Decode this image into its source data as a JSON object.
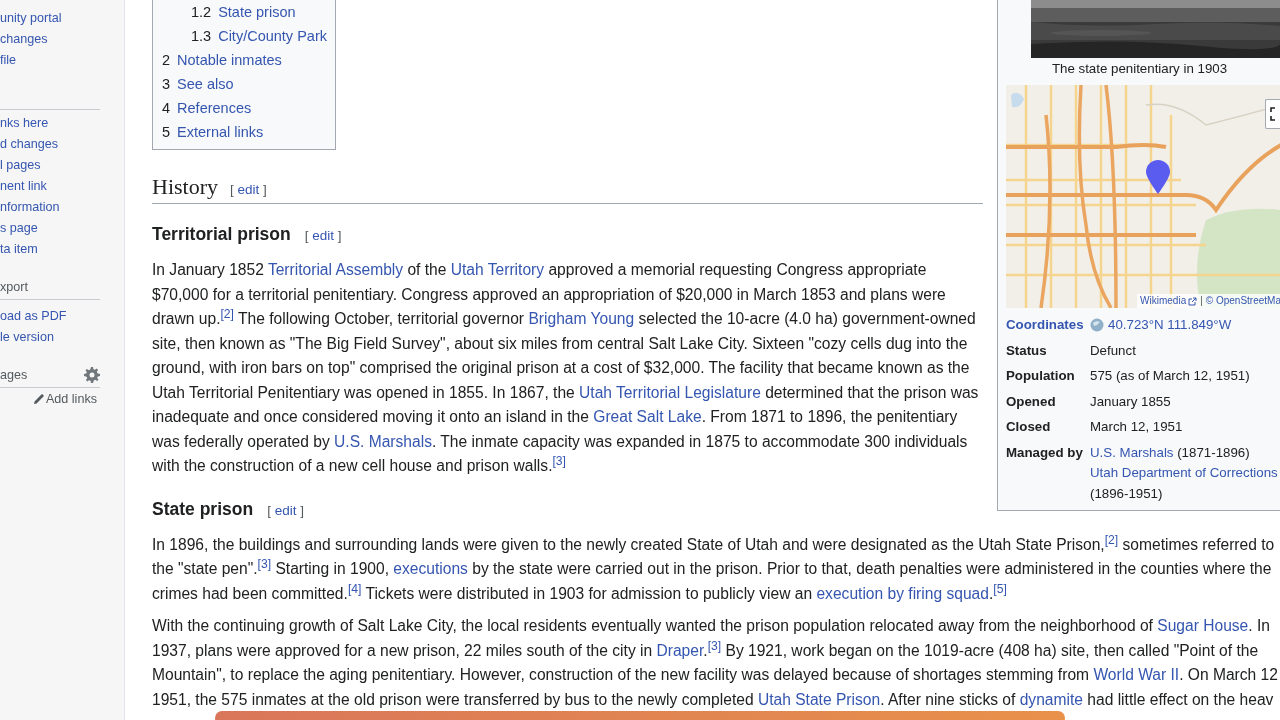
{
  "sidebar": {
    "groups": [
      {
        "items": [
          "unity portal",
          "changes",
          "file"
        ]
      },
      {
        "divider": true,
        "items": [
          "nks here",
          "d changes",
          "l pages",
          "nent link",
          "nformation",
          "s page",
          "ta item"
        ]
      },
      {
        "heading": "xport",
        "items": [
          "oad as PDF",
          "le version"
        ]
      },
      {
        "heading": "ages",
        "settings": true,
        "add_links": "Add links"
      }
    ]
  },
  "toc": {
    "items": [
      {
        "children": [
          {
            "number": "1.2",
            "label": "State prison"
          },
          {
            "number": "1.3",
            "label": "City/County Park"
          }
        ]
      },
      {
        "number": "2",
        "label": "Notable inmates"
      },
      {
        "number": "3",
        "label": "See also"
      },
      {
        "number": "4",
        "label": "References"
      },
      {
        "number": "5",
        "label": "External links"
      }
    ]
  },
  "sections": [
    {
      "kind": "h2",
      "title": "History",
      "edit": {
        "open": "[",
        "label": "edit",
        "close": "]"
      }
    },
    {
      "kind": "h3",
      "title": "Territorial prison",
      "edit": {
        "open": "[",
        "label": "edit",
        "close": "]"
      },
      "paragraphs": [
        [
          {
            "kind": "text",
            "text": "In January 1852 "
          },
          {
            "kind": "link",
            "text": "Territorial Assembly"
          },
          {
            "kind": "text",
            "text": " of the "
          },
          {
            "kind": "link",
            "text": "Utah Territory"
          },
          {
            "kind": "text",
            "text": " approved a memorial requesting Congress appropriate\n$70,000 for a territorial penitentiary. Congress approved an appropriation of $20,000 in March 1853 and plans were\ndrawn up."
          },
          {
            "kind": "ref",
            "text": "[2]"
          },
          {
            "kind": "text",
            "text": " The following October, territorial governor "
          },
          {
            "kind": "link",
            "text": "Brigham Young"
          },
          {
            "kind": "text",
            "text": " selected the 10-acre (4.0 ha) government-owned\nsite, then known as \"The Big Field Survey\", about six miles from central Salt Lake City. Sixteen \"cozy cells dug into the\nground, with iron bars on top\" comprised the original prison at a cost of $32,000. The facility that became known as the\nUtah Territorial Penitentiary was opened in 1855. In 1867, the "
          },
          {
            "kind": "link",
            "text": "Utah Territorial Legislature"
          },
          {
            "kind": "text",
            "text": " determined that the prison was\ninadequate and once considered moving it onto an island in the "
          },
          {
            "kind": "link",
            "text": "Great Salt Lake"
          },
          {
            "kind": "text",
            "text": ". From 1871 to 1896, the penitentiary\nwas federally operated by "
          },
          {
            "kind": "link",
            "text": "U.S. Marshals"
          },
          {
            "kind": "text",
            "text": ". The inmate capacity was expanded in 1875 to accommodate 300 individuals\nwith the construction of a new cell house and prison walls."
          },
          {
            "kind": "ref",
            "text": "[3]"
          }
        ]
      ]
    },
    {
      "kind": "h3",
      "title": "State prison",
      "edit": {
        "open": "[",
        "label": "edit",
        "close": "]"
      },
      "paragraphs": [
        [
          {
            "kind": "text",
            "text": "In 1896, the buildings and surrounding lands were given to the newly created State of Utah and were designated as the Utah State Prison,"
          },
          {
            "kind": "ref",
            "text": "[2]"
          },
          {
            "kind": "text",
            "text": " sometimes referred to\nthe \"state pen\"."
          },
          {
            "kind": "ref",
            "text": "[3]"
          },
          {
            "kind": "text",
            "text": " Starting in 1900, "
          },
          {
            "kind": "link",
            "text": "executions"
          },
          {
            "kind": "text",
            "text": " by the state were carried out in the prison. Prior to that, death penalties were administered in the counties where the\ncrimes had been committed."
          },
          {
            "kind": "ref",
            "text": "[4]"
          },
          {
            "kind": "text",
            "text": " Tickets were distributed in 1903 for admission to publicly view an "
          },
          {
            "kind": "link",
            "text": "execution by firing squad"
          },
          {
            "kind": "text",
            "text": "."
          },
          {
            "kind": "ref",
            "text": "[5]"
          }
        ],
        [
          {
            "kind": "text",
            "text": "With the continuing growth of Salt Lake City, the local residents eventually wanted the prison population relocated away from the neighborhood of "
          },
          {
            "kind": "link",
            "text": "Sugar House"
          },
          {
            "kind": "text",
            "text": ". In\n1937, plans were approved for a new prison, 22 miles south of the city in "
          },
          {
            "kind": "link",
            "text": "Draper"
          },
          {
            "kind": "text",
            "text": "."
          },
          {
            "kind": "ref",
            "text": "[3]"
          },
          {
            "kind": "text",
            "text": " By 1921, work began on the 1019-acre (408 ha) site, then called \"Point of the\nMountain\", to replace the aging penitentiary. However, construction of the new facility was delayed because of shortages stemming from "
          },
          {
            "kind": "link",
            "text": "World War II"
          },
          {
            "kind": "text",
            "text": ". On March 12\n1951, the 575 inmates at the old prison were transferred by bus to the newly completed "
          },
          {
            "kind": "link",
            "text": "Utah State Prison"
          },
          {
            "kind": "text",
            "text": ". After nine sticks of "
          },
          {
            "kind": "link",
            "text": "dynamite"
          },
          {
            "kind": "text",
            "text": " had little effect on the heav"
          }
        ]
      ]
    }
  ],
  "infobox": {
    "image": {
      "kind": "picture",
      "caption": "The state penitentiary in 1903"
    },
    "map": {
      "kind": "picture",
      "fullscreen": true,
      "attribution": [
        {
          "text": "Wikimedia",
          "external": true
        },
        {
          "text": "|",
          "kind": "separator"
        },
        {
          "text": "© OpenStreetMa"
        }
      ]
    },
    "rows": [
      {
        "kind": "coordinates",
        "label": "Coordinates",
        "value": [
          {
            "kind": "link",
            "text": "40.723°N 111.849°W"
          }
        ]
      },
      {
        "kind": "plain",
        "label": "Status",
        "value": [
          {
            "kind": "text",
            "text": "Defunct"
          }
        ]
      },
      {
        "kind": "plain",
        "label": "Population",
        "value": [
          {
            "kind": "text",
            "text": "575 (as of March 12, 1951)"
          }
        ]
      },
      {
        "kind": "plain",
        "label": "Opened",
        "value": [
          {
            "kind": "text",
            "text": "January 1855"
          }
        ]
      },
      {
        "kind": "plain",
        "label": "Closed",
        "value": [
          {
            "kind": "text",
            "text": "March 12, 1951"
          }
        ]
      },
      {
        "kind": "plain",
        "label": "Managed by",
        "value": [
          {
            "kind": "link",
            "text": "U.S. Marshals"
          },
          {
            "kind": "text",
            "text": " (1871-1896)\n"
          },
          {
            "kind": "link",
            "text": "Utah Department of Corrections"
          },
          {
            "kind": "text",
            "text": "\n(1896-1951)"
          }
        ]
      }
    ]
  },
  "overlay": {
    "kind": "bar"
  }
}
